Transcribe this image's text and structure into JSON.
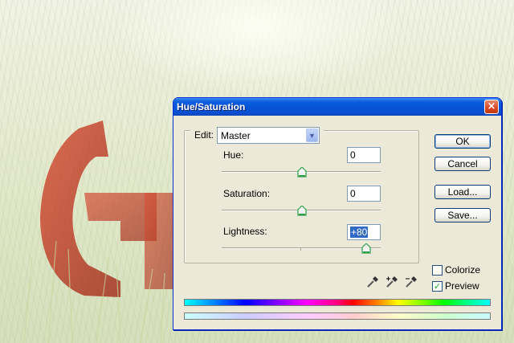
{
  "dialog": {
    "title": "Hue/Saturation",
    "close_icon": "close-icon",
    "edit": {
      "label": "Edit:",
      "value": "Master"
    },
    "sliders": [
      {
        "label": "Hue:",
        "value": "0",
        "position": 0.5
      },
      {
        "label": "Saturation:",
        "value": "0",
        "position": 0.5
      },
      {
        "label": "Lightness:",
        "value": "+80",
        "position": 0.9,
        "selected": true
      }
    ],
    "buttons": {
      "ok": "OK",
      "cancel": "Cancel",
      "load": "Load...",
      "save": "Save..."
    },
    "checkboxes": {
      "colorize": {
        "label": "Colorize",
        "checked": false
      },
      "preview": {
        "label": "Preview",
        "checked": true
      }
    },
    "eyedroppers": [
      "eyedropper-icon",
      "eyedropper-plus-icon",
      "eyedropper-minus-icon"
    ],
    "colors": {
      "title_bar": "#0553d6",
      "dialog_bg": "#ece9d8",
      "thumb": "#2e9f48",
      "selection": "#316ac5"
    }
  }
}
